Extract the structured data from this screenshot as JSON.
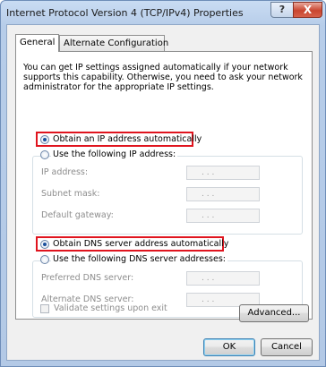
{
  "window": {
    "title": "Internet Protocol Version 4 (TCP/IPv4) Properties",
    "help_glyph": "?",
    "close_glyph": "X"
  },
  "tabs": [
    {
      "label": "General",
      "selected": true
    },
    {
      "label": "Alternate Configuration",
      "selected": false
    }
  ],
  "intro_text": "You can get IP settings assigned automatically if your network supports this capability. Otherwise, you need to ask your network administrator for the appropriate IP settings.",
  "ip": {
    "auto_label": "Obtain an IP address automatically",
    "auto_selected": true,
    "manual_label": "Use the following IP address:",
    "fields": [
      {
        "label": "IP address:",
        "value": ".   .   ."
      },
      {
        "label": "Subnet mask:",
        "value": ".   .   ."
      },
      {
        "label": "Default gateway:",
        "value": ".   .   ."
      }
    ]
  },
  "dns": {
    "auto_label": "Obtain DNS server address automatically",
    "auto_selected": true,
    "manual_label": "Use the following DNS server addresses:",
    "fields": [
      {
        "label": "Preferred DNS server:",
        "value": ".   .   ."
      },
      {
        "label": "Alternate DNS server:",
        "value": ".   .   ."
      }
    ]
  },
  "validate_label": "Validate settings upon exit",
  "validate_checked": false,
  "buttons": {
    "advanced": "Advanced...",
    "ok": "OK",
    "cancel": "Cancel"
  },
  "colors": {
    "highlight": "#e0141e",
    "selection_dot": "#1a4f9c"
  }
}
